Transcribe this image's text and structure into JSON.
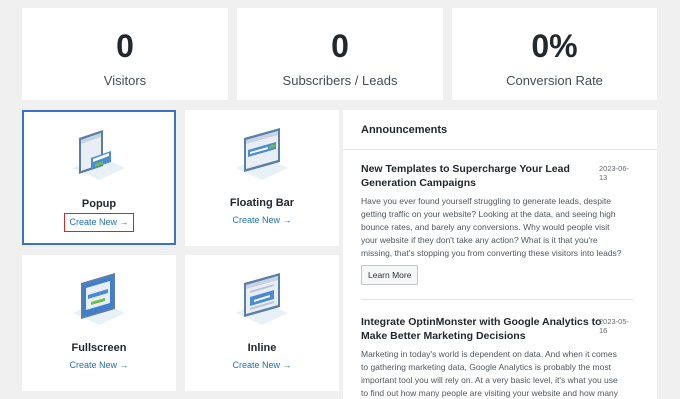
{
  "stats": [
    {
      "value": "0",
      "label": "Visitors"
    },
    {
      "value": "0",
      "label": "Subscribers / Leads"
    },
    {
      "value": "0%",
      "label": "Conversion Rate"
    }
  ],
  "campaign_types": [
    {
      "title": "Popup",
      "link": "Create New →",
      "selected": true,
      "icon": "popup-illustration-icon"
    },
    {
      "title": "Floating Bar",
      "link": "Create New →",
      "selected": false,
      "icon": "floating-bar-illustration-icon"
    },
    {
      "title": "Fullscreen",
      "link": "Create New →",
      "selected": false,
      "icon": "fullscreen-illustration-icon"
    },
    {
      "title": "Inline",
      "link": "Create New →",
      "selected": false,
      "icon": "inline-illustration-icon"
    }
  ],
  "announcements": {
    "heading": "Announcements",
    "items": [
      {
        "title": "New Templates to Supercharge Your Lead Generation Campaigns",
        "date": "2023-06-13",
        "body": "Have you ever found yourself struggling to generate leads, despite getting traffic on your website? Looking at the data, and seeing high bounce rates, and barely any conversions. Why would people visit your website if they don't take any action? What is it that you're missing, that's stopping you from converting these visitors into leads? ...",
        "button": "Learn More"
      },
      {
        "title": "Integrate OptinMonster with Google Analytics to Make Better Marketing Decisions",
        "date": "2023-05-16",
        "body": "Marketing in today's world is dependent on data. And when it comes to gathering marketing data, Google Analytics is probably the most important tool you will rely on. At a very basic level, it's what you use to find out how many people are visiting your website and how many are"
      }
    ]
  },
  "colors": {
    "accent": "#2271b1",
    "selected_border": "#3c73c9",
    "highlight": "#d6252b",
    "background": "#f0f0f1"
  }
}
